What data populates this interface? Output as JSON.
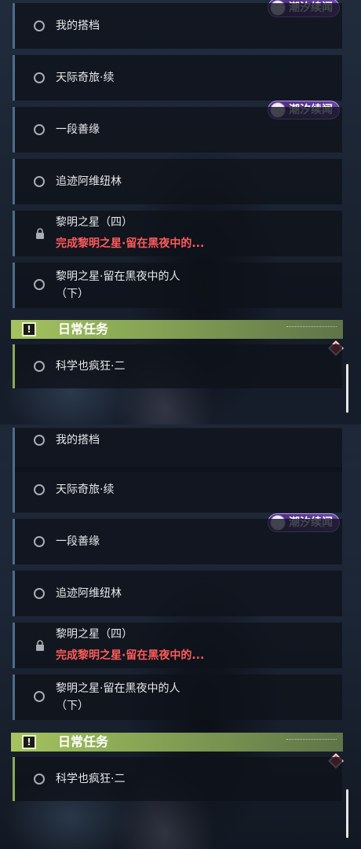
{
  "quests": [
    {
      "title": "我的搭档",
      "status": "circle"
    },
    {
      "title": "天际奇旅·续",
      "status": "circle"
    },
    {
      "title": "一段善缘",
      "status": "circle"
    },
    {
      "title": "追迹阿维纽林",
      "status": "circle"
    },
    {
      "title": "黎明之星（四）",
      "subtitle": "完成黎明之星·留在黑夜中的...",
      "status": "locked"
    },
    {
      "title": "黎明之星·留在黑夜中的人",
      "title_line2": "（下）",
      "status": "circle"
    }
  ],
  "badge": {
    "label": "潮汐续闻",
    "icon": "tide-news-icon"
  },
  "daily_section": {
    "label": "日常任务",
    "icon": "exclamation-icon"
  },
  "daily_quests": [
    {
      "title": "科学也疯狂·二",
      "status": "circle"
    }
  ],
  "colors": {
    "accent_blue": "#4a6e88",
    "accent_green": "#8aa956",
    "warning_red": "#ff5b5b",
    "badge_purple": "#6a45a8"
  }
}
